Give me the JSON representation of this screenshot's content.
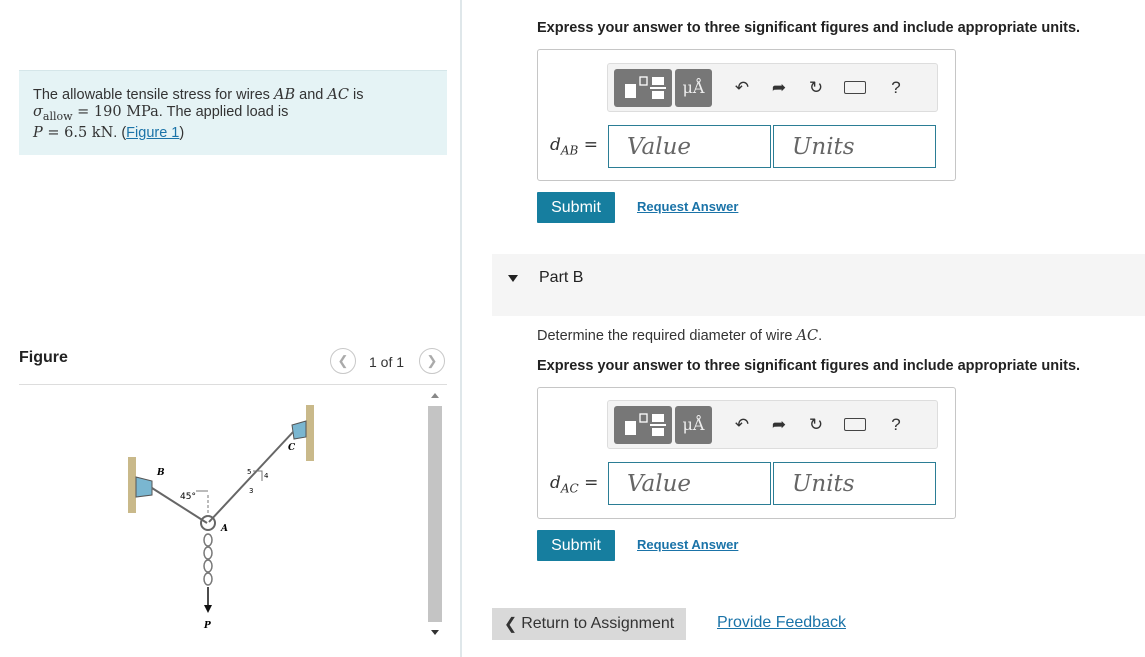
{
  "problem": {
    "text_1": "The allowable tensile stress for wires ",
    "ab": "AB",
    "and": " and ",
    "ac": "AC",
    "is": " is",
    "sigma": "σ",
    "allow": "allow",
    "equals_190": " = 190 MPa",
    "applied": ". The applied load is",
    "p": "P",
    "equals_p": " = 6.5 kN",
    "period": ". (",
    "figure_link": "Figure 1",
    "close": ")"
  },
  "figure": {
    "title": "Figure",
    "page_count": "1 of 1",
    "prev_icon": "chevron-left-icon",
    "next_icon": "chevron-right-icon",
    "labels": {
      "b": "B",
      "c": "C",
      "a": "A",
      "p": "P",
      "angle": "45°",
      "five": "5",
      "four": "4",
      "three": "3"
    }
  },
  "part_a": {
    "instruction": "Express your answer to three significant figures and include appropriate units.",
    "var_main": "d",
    "var_sub": "AB",
    "equals": "=",
    "value_placeholder": "Value",
    "units_placeholder": "Units",
    "submit": "Submit",
    "request": "Request Answer"
  },
  "toolbar": {
    "mu_label": "μÅ",
    "undo_icon": "undo-icon",
    "redo_icon": "redo-icon",
    "reset_icon": "reset-icon",
    "keyboard_icon": "keyboard-icon",
    "help": "?"
  },
  "part_b": {
    "title": "Part B",
    "question": "Determine the required diameter of wire ",
    "question_var": "AC",
    "question_end": ".",
    "instruction": "Express your answer to three significant figures and include appropriate units.",
    "var_main": "d",
    "var_sub": "AC",
    "equals": "=",
    "value_placeholder": "Value",
    "units_placeholder": "Units",
    "submit": "Submit",
    "request": "Request Answer"
  },
  "footer": {
    "return": "Return to Assignment",
    "feedback": "Provide Feedback"
  }
}
